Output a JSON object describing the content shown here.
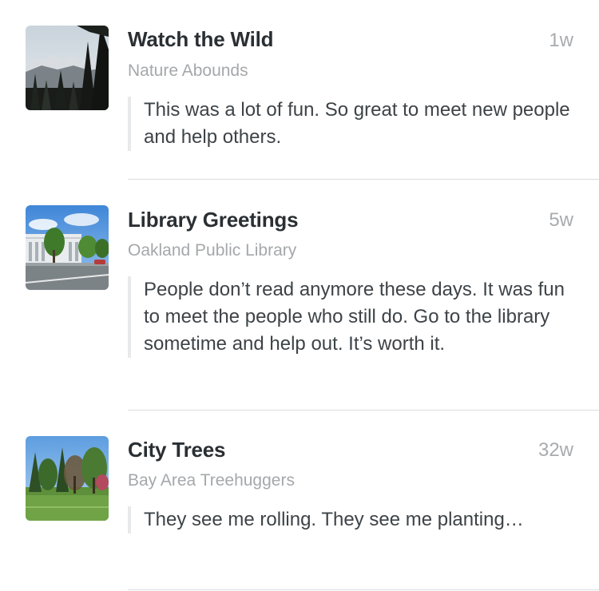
{
  "feed": {
    "items": [
      {
        "title": "Watch the Wild",
        "organization": "Nature Abounds",
        "age": "1w",
        "comment": "This was a lot of fun. So great to meet new people and help others.",
        "thumbnail": "mountain-forest-photo"
      },
      {
        "title": "Library Greetings",
        "organization": "Oakland Public Library",
        "age": "5w",
        "comment": "People don’t read anymore these days. It was fun to meet the people who still do. Go to the library sometime and help out. It’s worth it.",
        "thumbnail": "library-building-photo"
      },
      {
        "title": "City Trees",
        "organization": "Bay Area Treehuggers",
        "age": "32w",
        "comment": "They see me rolling. They see me planting…",
        "thumbnail": "park-trees-photo"
      }
    ]
  }
}
